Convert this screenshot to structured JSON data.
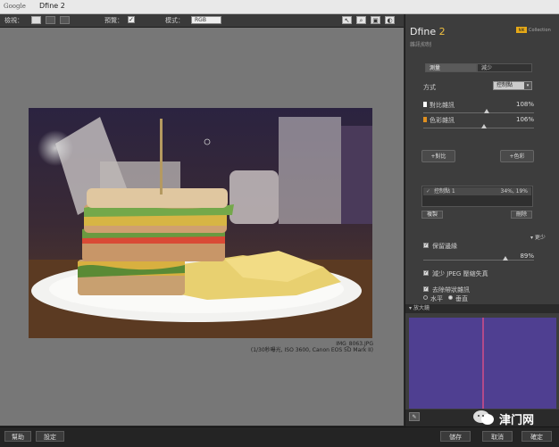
{
  "window": {
    "logo": "Google",
    "title": "Dfine 2"
  },
  "toolbar": {
    "view_label": "檢視：",
    "preview_label": "預覽：",
    "preview_checked": "✓",
    "mode_label": "模式：",
    "mode_value": "RGB"
  },
  "canvas": {
    "filename": "IMG_8063.JPG",
    "caption": "(1/30秒曝光, ISO 3600, Canon EOS 5D Mark II)"
  },
  "panel": {
    "brand": "Dfine",
    "brand_version": "2",
    "subtitle": "雜訊抑制",
    "logo_text": "NIK",
    "collection": "Collection",
    "tabs": [
      "測量",
      "減少"
    ],
    "method_label": "方式",
    "method_value": "控制點",
    "contrast_label": "對比雜訊",
    "contrast_value": "108%",
    "contrast_level": 0.57,
    "color_label": "色彩雜訊",
    "color_value": "106%",
    "color_level": 0.55,
    "cp_add_a": "+對比",
    "cp_add_b": "+色彩",
    "cp_item": "控制點 1",
    "cp_item_values": "34%, 19%",
    "cp_left_btn": "複製",
    "cp_right_btn": "刪除",
    "more": "▾ 更少",
    "preserve_label": "保留邊緣",
    "preserve_value": "89%",
    "preserve_level": 0.74,
    "jpeg_label": "減少 JPEG 壓縮失真",
    "remove_label": "去除帶狀雜訊",
    "horizontal": "水平",
    "vertical": "垂直",
    "loupe_label": "放大鏡"
  },
  "bottom": {
    "help": "幫助",
    "settings": "設定",
    "ok": "確定",
    "cancel": "取消",
    "save": "儲存"
  },
  "watermark": {
    "text": "津门网"
  }
}
